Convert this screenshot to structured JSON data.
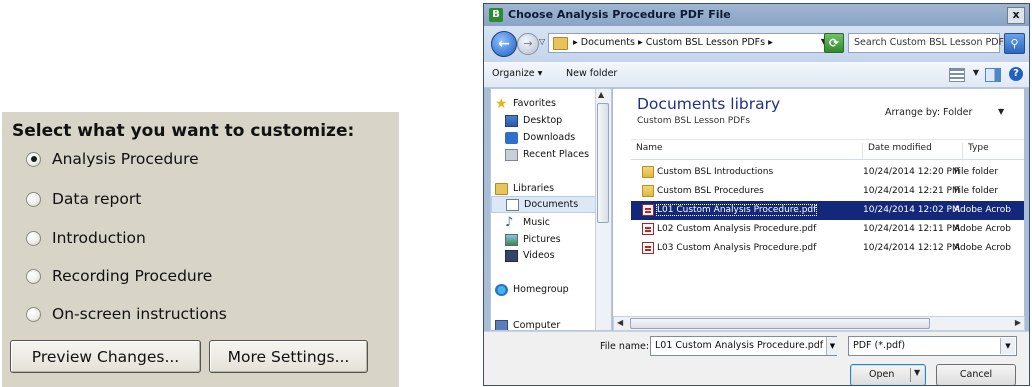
{
  "customize": {
    "title": "Select what you want to customize:",
    "options": [
      {
        "label": "Analysis Procedure",
        "checked": true
      },
      {
        "label": "Data report",
        "checked": false
      },
      {
        "label": "Introduction",
        "checked": false
      },
      {
        "label": "Recording Procedure",
        "checked": false
      },
      {
        "label": "On-screen instructions",
        "checked": false
      }
    ],
    "preview_button": "Preview Changes...",
    "settings_button": "More Settings..."
  },
  "dialog": {
    "title": "Choose Analysis Procedure PDF File",
    "close": "x",
    "address_path": "▸ Documents ▸ Custom BSL Lesson PDFs ▸",
    "search_placeholder": "Search Custom BSL Lesson PDFs",
    "toolbar": {
      "organize": "Organize ▾",
      "new_folder": "New folder"
    },
    "nav": {
      "favorites": "Favorites",
      "desktop": "Desktop",
      "downloads": "Downloads",
      "recent": "Recent Places",
      "libraries": "Libraries",
      "documents": "Documents",
      "music": "Music",
      "pictures": "Pictures",
      "videos": "Videos",
      "homegroup": "Homegroup",
      "computer": "Computer"
    },
    "library": {
      "title": "Documents library",
      "subtitle": "Custom BSL Lesson PDFs",
      "arrange_label": "Arrange by:  Folder"
    },
    "columns": {
      "name": "Name",
      "date": "Date modified",
      "type": "Type"
    },
    "files": [
      {
        "name": "Custom BSL Introductions",
        "date": "10/24/2014 12:20 PM",
        "type": "File folder",
        "icon": "folder-icon"
      },
      {
        "name": "Custom BSL Procedures",
        "date": "10/24/2014 12:21 PM",
        "type": "File folder",
        "icon": "folder-icon"
      },
      {
        "name": "L01 Custom Analysis Procedure.pdf",
        "date": "10/24/2014 12:02 PM",
        "type": "Adobe Acrob",
        "icon": "pdf-icon"
      },
      {
        "name": "L02 Custom Analysis Procedure.pdf",
        "date": "10/24/2014 12:11 PM",
        "type": "Adobe Acrob",
        "icon": "pdf-icon"
      },
      {
        "name": "L03 Custom Analysis Procedure.pdf",
        "date": "10/24/2014 12:12 PM",
        "type": "Adobe Acrob",
        "icon": "pdf-icon"
      }
    ],
    "selected_file_index": 2,
    "filename_label": "File name:",
    "filename_value": "L01 Custom Analysis Procedure.pdf",
    "filetype_value": "PDF (*.pdf)",
    "open_button": "Open",
    "cancel_button": "Cancel"
  }
}
